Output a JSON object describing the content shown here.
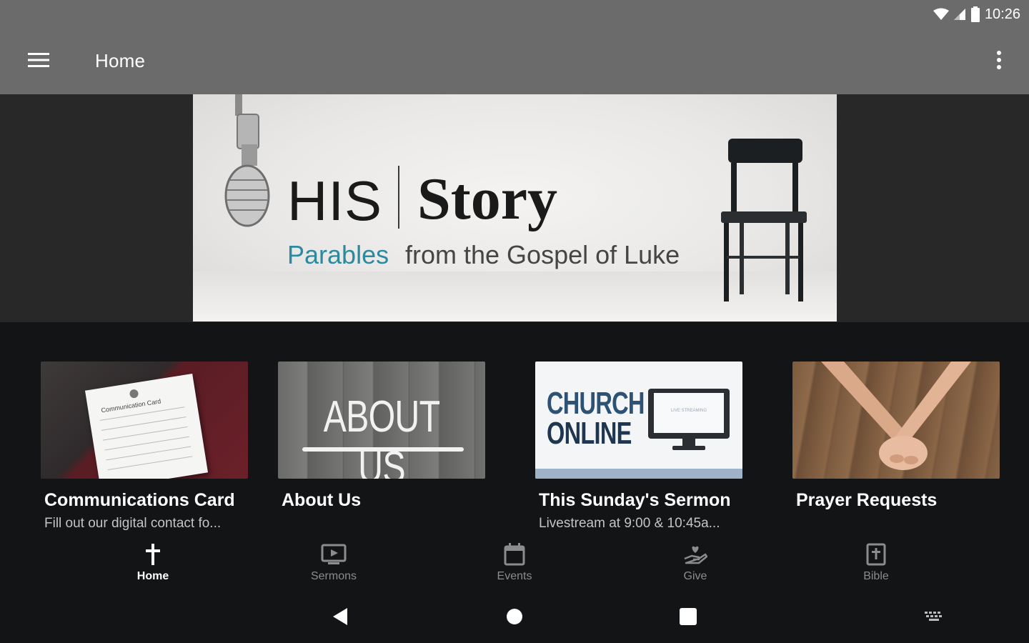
{
  "status_bar": {
    "time": "10:26"
  },
  "app_bar": {
    "title": "Home"
  },
  "hero": {
    "title_part1": "HIS",
    "title_part2": "Story",
    "subtitle_highlight": "Parables",
    "subtitle_rest": "from the Gospel of Luke"
  },
  "cards": [
    {
      "title": "Communications Card",
      "subtitle": "Fill out our digital contact fo...",
      "thumb_text": "Communication Card"
    },
    {
      "title": "About Us",
      "subtitle": "",
      "thumb_text": "ABOUT US"
    },
    {
      "title": "This Sunday's Sermon",
      "subtitle": "Livestream at 9:00 & 10:45a...",
      "thumb_line1": "CHURCH",
      "thumb_line2": "ONLINE",
      "thumb_screen": "LIVE STREAMING"
    },
    {
      "title": "Prayer Requests",
      "subtitle": ""
    }
  ],
  "bottom_nav": [
    {
      "label": "Home",
      "icon": "cross-icon",
      "active": true
    },
    {
      "label": "Sermons",
      "icon": "tv-play-icon",
      "active": false
    },
    {
      "label": "Events",
      "icon": "calendar-icon",
      "active": false
    },
    {
      "label": "Give",
      "icon": "give-hand-heart-icon",
      "active": false
    },
    {
      "label": "Bible",
      "icon": "bible-book-icon",
      "active": false
    }
  ],
  "colors": {
    "app_bar": "#6b6b6b",
    "background": "#131416",
    "hero_band": "#282828",
    "accent_teal": "#2b8a9e",
    "church_online_blue": "#2d5274"
  }
}
